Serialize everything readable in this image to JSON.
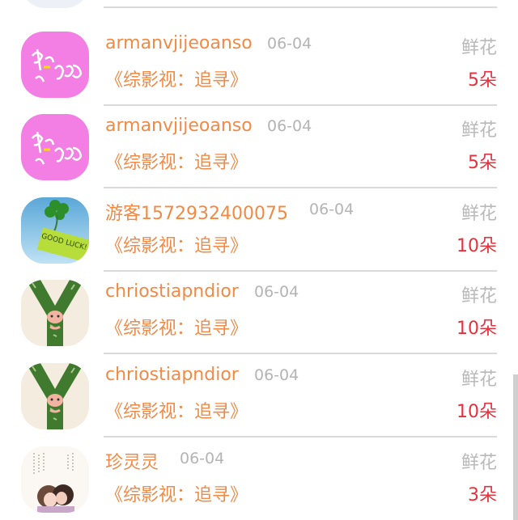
{
  "rows": [
    {
      "username": "armanvjijeoanso",
      "date": "06-04",
      "gift": "鲜花",
      "title": "《综影视：追寻》",
      "amount": "5朵"
    },
    {
      "username": "armanvjijeoanso",
      "date": "06-04",
      "gift": "鲜花",
      "title": "《综影视：追寻》",
      "amount": "5朵"
    },
    {
      "username": "游客1572932400075",
      "date": "06-04",
      "gift": "鲜花",
      "title": "《综影视：追寻》",
      "amount": "10朵"
    },
    {
      "username": "chriostiapndior",
      "date": "06-04",
      "gift": "鲜花",
      "title": "《综影视：追寻》",
      "amount": "10朵"
    },
    {
      "username": "chriostiapndior",
      "date": "06-04",
      "gift": "鲜花",
      "title": "《综影视：追寻》",
      "amount": "10朵"
    },
    {
      "username": "珍灵灵",
      "date": "06-04",
      "gift": "鲜花",
      "title": "《综影视：追寻》",
      "amount": "3朵"
    }
  ],
  "avatars": {
    "clover_text": "GOOD LUCK!"
  },
  "colors": {
    "username": "#f08a45",
    "title": "#f08a45",
    "date": "#b4b4b4",
    "gift": "#b9b9b9",
    "amount": "#e4313d",
    "divider": "#d9d9d9"
  }
}
